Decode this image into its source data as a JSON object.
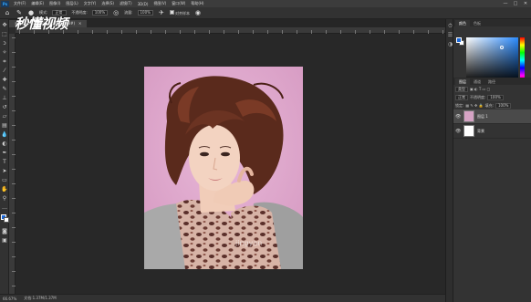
{
  "app": {
    "logo_text": "Ps"
  },
  "menu": {
    "items": [
      "文件(F)",
      "编辑(E)",
      "图像(I)",
      "图层(L)",
      "文字(Y)",
      "选择(S)",
      "滤镜(T)",
      "3D(D)",
      "视图(V)",
      "窗口(W)",
      "帮助(H)"
    ]
  },
  "window_controls": {
    "minimize": "—",
    "maximize": "□",
    "close": "✕"
  },
  "options_bar": {
    "mode_label": "模式:",
    "mode_value": "正常",
    "opacity_label": "不透明度:",
    "opacity_value": "100%",
    "flow_label": "流量:",
    "flow_value": "100%",
    "align_label": "对齐样本"
  },
  "document": {
    "tab_label": "未标题-1 @ 66.7% (背景, RGB/8#)",
    "close_glyph": "×",
    "watermark_text": "jingyan"
  },
  "status_bar": {
    "zoom": "66.67%",
    "doc_info": "文档:1.37M/1.37M"
  },
  "overlay_watermark": "秒懂视频",
  "color_panel": {
    "tab_color": "颜色",
    "tab_swatches": "色板",
    "fg_color": "#1866d8",
    "bg_color": "#ffffff"
  },
  "layers_panel": {
    "tab_layers": "图层",
    "tab_channels": "通道",
    "tab_paths": "路径",
    "filter_label": "类型",
    "blend_mode": "正常",
    "opacity_label": "不透明度:",
    "opacity_value": "100%",
    "lock_label": "锁定:",
    "fill_label": "填充:",
    "fill_value": "100%",
    "layers": [
      {
        "name": "图层 1",
        "selected": true
      },
      {
        "name": "背景",
        "selected": false
      }
    ]
  }
}
